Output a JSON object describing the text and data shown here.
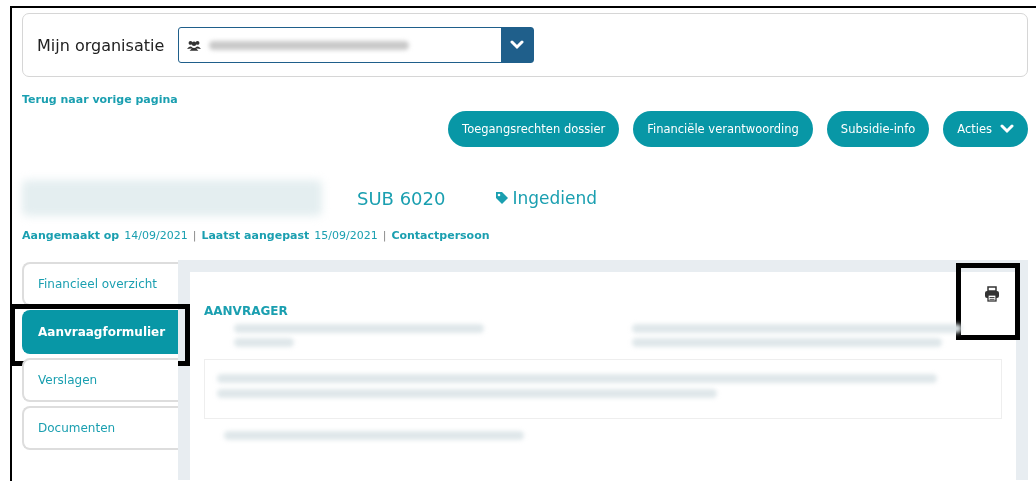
{
  "organisation": {
    "label": "Mijn organisatie"
  },
  "back_link": "Terug naar vorige pagina",
  "actions": [
    {
      "label": "Toegangsrechten dossier",
      "kind": "button"
    },
    {
      "label": "Financiële verantwoording",
      "kind": "button"
    },
    {
      "label": "Subsidie-info",
      "kind": "button"
    },
    {
      "label": "Acties",
      "kind": "dropdown"
    }
  ],
  "dossier": {
    "number": "SUB 6020",
    "status": "Ingediend"
  },
  "meta": [
    {
      "label": "Aangemaakt op",
      "value": "14/09/2021"
    },
    {
      "separator": "|",
      "label": "Laatst aangepast",
      "value": "15/09/2021"
    },
    {
      "separator": "|",
      "label": "Contactpersoon"
    }
  ],
  "tabs": [
    {
      "label": "Financieel overzicht",
      "selected": false,
      "highlighted": false
    },
    {
      "label": "Aanvraagformulier",
      "selected": true,
      "highlighted": true
    },
    {
      "label": "Verslagen",
      "selected": false,
      "highlighted": false
    },
    {
      "label": "Documenten",
      "selected": false,
      "highlighted": false
    }
  ],
  "print_button": {
    "highlighted": true
  },
  "section": {
    "heading": "AANVRAGER"
  }
}
